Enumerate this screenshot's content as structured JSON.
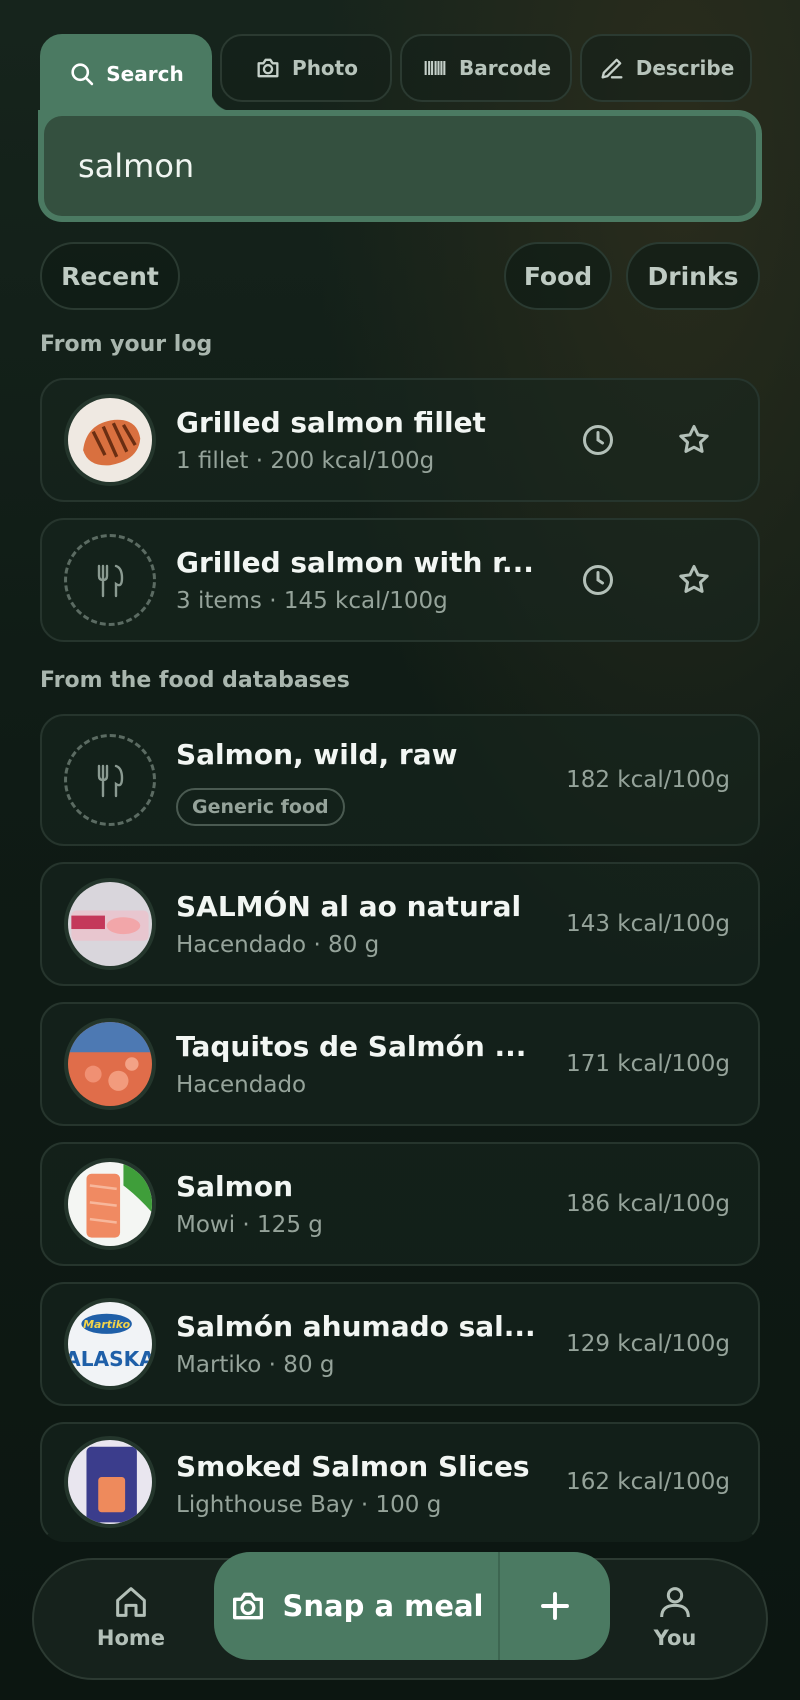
{
  "tabs": [
    {
      "label": "Search",
      "icon": "search-icon",
      "active": true
    },
    {
      "label": "Photo",
      "icon": "camera-icon"
    },
    {
      "label": "Barcode",
      "icon": "barcode-icon"
    },
    {
      "label": "Describe",
      "icon": "pencil-icon"
    }
  ],
  "search": {
    "value": "salmon",
    "placeholder": ""
  },
  "filters": {
    "recent": "Recent",
    "food": "Food",
    "drinks": "Drinks"
  },
  "sections": {
    "log": "From your log",
    "databases": "From the food databases"
  },
  "log_items": [
    {
      "title": "Grilled salmon fillet",
      "subtitle": "1 fillet · 200 kcal/100g",
      "image": "grilled-salmon"
    },
    {
      "title": "Grilled salmon with r...",
      "subtitle": "3 items · 145 kcal/100g",
      "image": "placeholder"
    }
  ],
  "db_items": [
    {
      "title": "Salmon, wild, raw",
      "badge": "Generic food",
      "kcal": "182 kcal/100g",
      "image": "placeholder"
    },
    {
      "title": "SALMÓN al ao natural",
      "subtitle": "Hacendado · 80 g",
      "kcal": "143 kcal/100g",
      "image": "salmon-can"
    },
    {
      "title": "Taquitos de Salmón ...",
      "subtitle": "Hacendado",
      "kcal": "171 kcal/100g",
      "image": "salmon-pack"
    },
    {
      "title": "Salmon",
      "subtitle": "Mowi · 125 g",
      "kcal": "186 kcal/100g",
      "image": "salmon-fillet-pack"
    },
    {
      "title": "Salmón ahumado sal...",
      "subtitle": "Martiko · 80 g",
      "kcal": "129 kcal/100g",
      "image": "martiko-alaska"
    },
    {
      "title": "Smoked Salmon Slices",
      "subtitle": "Lighthouse Bay · 100 g",
      "kcal": "162 kcal/100g",
      "image": "smoked-salmon"
    }
  ],
  "thumb_text": {
    "martiko": "Martiko",
    "alaska": "ALASKA"
  },
  "bottom_nav": {
    "home": "Home",
    "snap": "Snap a meal",
    "you": "You"
  },
  "colors": {
    "accent": "#4b7a62",
    "background": "#0f1b15"
  }
}
